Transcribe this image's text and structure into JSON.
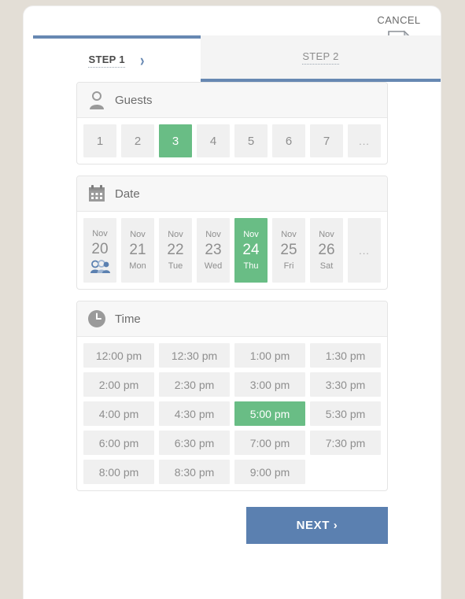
{
  "header": {
    "cancel_label": "CANCEL",
    "cancel_icon": "document-cancel-icon"
  },
  "tabs": [
    {
      "label": "STEP 1",
      "active": true,
      "chevron": "›"
    },
    {
      "label": "STEP 2",
      "active": false
    }
  ],
  "colors": {
    "selected_green": "#69bd85",
    "accent_blue": "#6788b2",
    "next_button_blue": "#5b80b0",
    "page_background": "#e3ded6",
    "cell_grey": "#f0f0f0"
  },
  "guests": {
    "title": "Guests",
    "icon": "person-icon",
    "options": [
      "1",
      "2",
      "3",
      "4",
      "5",
      "6",
      "7",
      "..."
    ],
    "selected": "3"
  },
  "date": {
    "title": "Date",
    "icon": "calendar-icon",
    "options": [
      {
        "month": "Nov",
        "day": "20",
        "weekday": "",
        "icon": "people-group-icon"
      },
      {
        "month": "Nov",
        "day": "21",
        "weekday": "Mon"
      },
      {
        "month": "Nov",
        "day": "22",
        "weekday": "Tue"
      },
      {
        "month": "Nov",
        "day": "23",
        "weekday": "Wed"
      },
      {
        "month": "Nov",
        "day": "24",
        "weekday": "Thu"
      },
      {
        "month": "Nov",
        "day": "25",
        "weekday": "Fri"
      },
      {
        "month": "Nov",
        "day": "26",
        "weekday": "Sat"
      },
      {
        "month": "",
        "day": "",
        "weekday": "",
        "ellipsis": "..."
      }
    ],
    "selected_day": "24"
  },
  "time": {
    "title": "Time",
    "icon": "clock-icon",
    "options": [
      "12:00 pm",
      "12:30 pm",
      "1:00 pm",
      "1:30 pm",
      "2:00 pm",
      "2:30 pm",
      "3:00 pm",
      "3:30 pm",
      "4:00 pm",
      "4:30 pm",
      "5:00 pm",
      "5:30 pm",
      "6:00 pm",
      "6:30 pm",
      "7:00 pm",
      "7:30 pm",
      "8:00 pm",
      "8:30 pm",
      "9:00 pm"
    ],
    "selected": "5:00 pm"
  },
  "footer": {
    "next_label": "NEXT  ›"
  }
}
